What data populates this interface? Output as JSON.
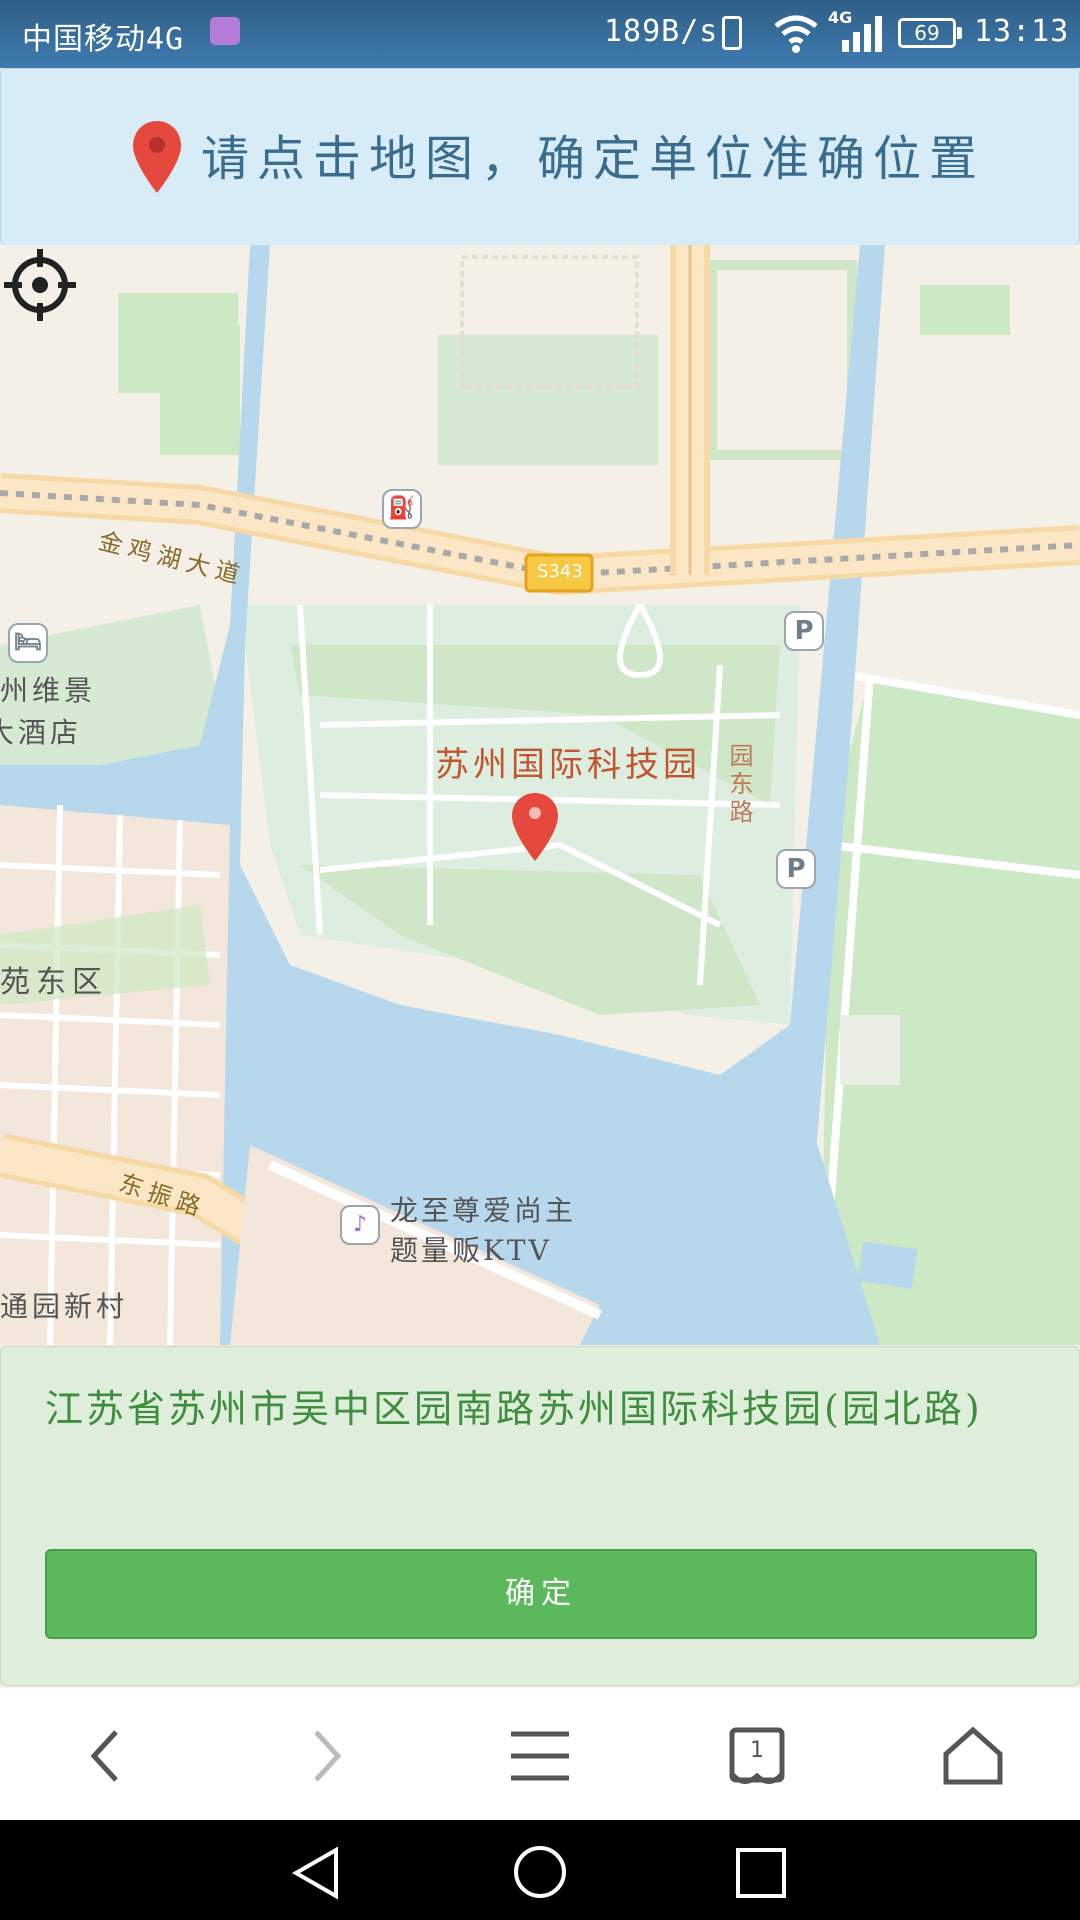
{
  "status_bar": {
    "carrier": "中国移动4G",
    "speed": "189B/s",
    "network": "4G",
    "battery": "69",
    "time": "13:13"
  },
  "banner": {
    "icon": "map-pin-icon",
    "message": "请点击地图，确定单位准确位置"
  },
  "map": {
    "labels": {
      "road_jinji": "金鸡湖大道",
      "highway_badge": "S343",
      "hotel_line1": "州维景",
      "hotel_line2": "大酒店",
      "park": "苏州国际科技园",
      "yuandong_road": "园东路",
      "district": "苑东区",
      "dongzhen_road": "东振路",
      "ktv_line1": "龙至尊爱尚主",
      "ktv_line2": "题量贩KTV",
      "village": "通园新村"
    },
    "icons": [
      "gas-station-icon",
      "hotel-icon",
      "parking-icon",
      "ktv-icon",
      "locate-icon"
    ],
    "colors": {
      "water": "#b7d7ec",
      "green": "#cde8c5",
      "road": "#fbe7c6",
      "pin": "#e5493d"
    }
  },
  "panel": {
    "address": "江苏省苏州市吴中区园南路苏州国际科技园(园北路)",
    "confirm_label": "确定",
    "colors": {
      "button": "#5cb85c",
      "text": "#3f8d3f"
    }
  },
  "browser_bar": {
    "tab_count": "1",
    "icons": [
      "back-icon",
      "forward-icon",
      "menu-icon",
      "tabs-icon",
      "home-icon"
    ]
  },
  "nav_bar": {
    "icons": [
      "nav-back-icon",
      "nav-home-icon",
      "nav-recents-icon"
    ]
  }
}
